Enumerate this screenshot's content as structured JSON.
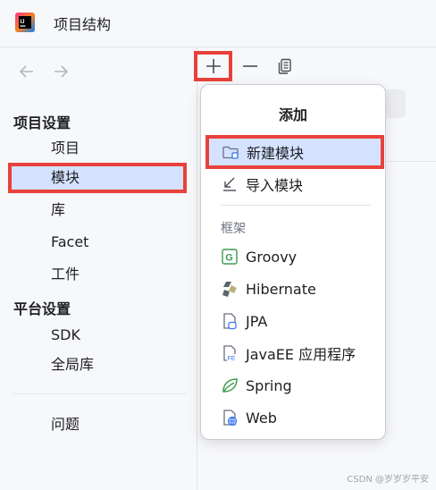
{
  "window": {
    "title": "项目结构"
  },
  "sidebar": {
    "project_settings_title": "项目设置",
    "project_items": [
      "项目",
      "模块",
      "库",
      "Facet",
      "工件"
    ],
    "platform_settings_title": "平台设置",
    "platform_items": [
      "SDK",
      "全局库"
    ],
    "problems": "问题",
    "selected": "模块"
  },
  "popup": {
    "title": "添加",
    "new_module": "新建模块",
    "import_module": "导入模块",
    "frameworks_label": "框架",
    "frameworks": [
      "Groovy",
      "Hibernate",
      "JPA",
      "JavaEE 应用程序",
      "Spring",
      "Web"
    ]
  },
  "watermark": "CSDN @岁岁岁平安",
  "colors": {
    "highlight_border": "#e8413b",
    "selection_bg": "#d4e2ff"
  }
}
